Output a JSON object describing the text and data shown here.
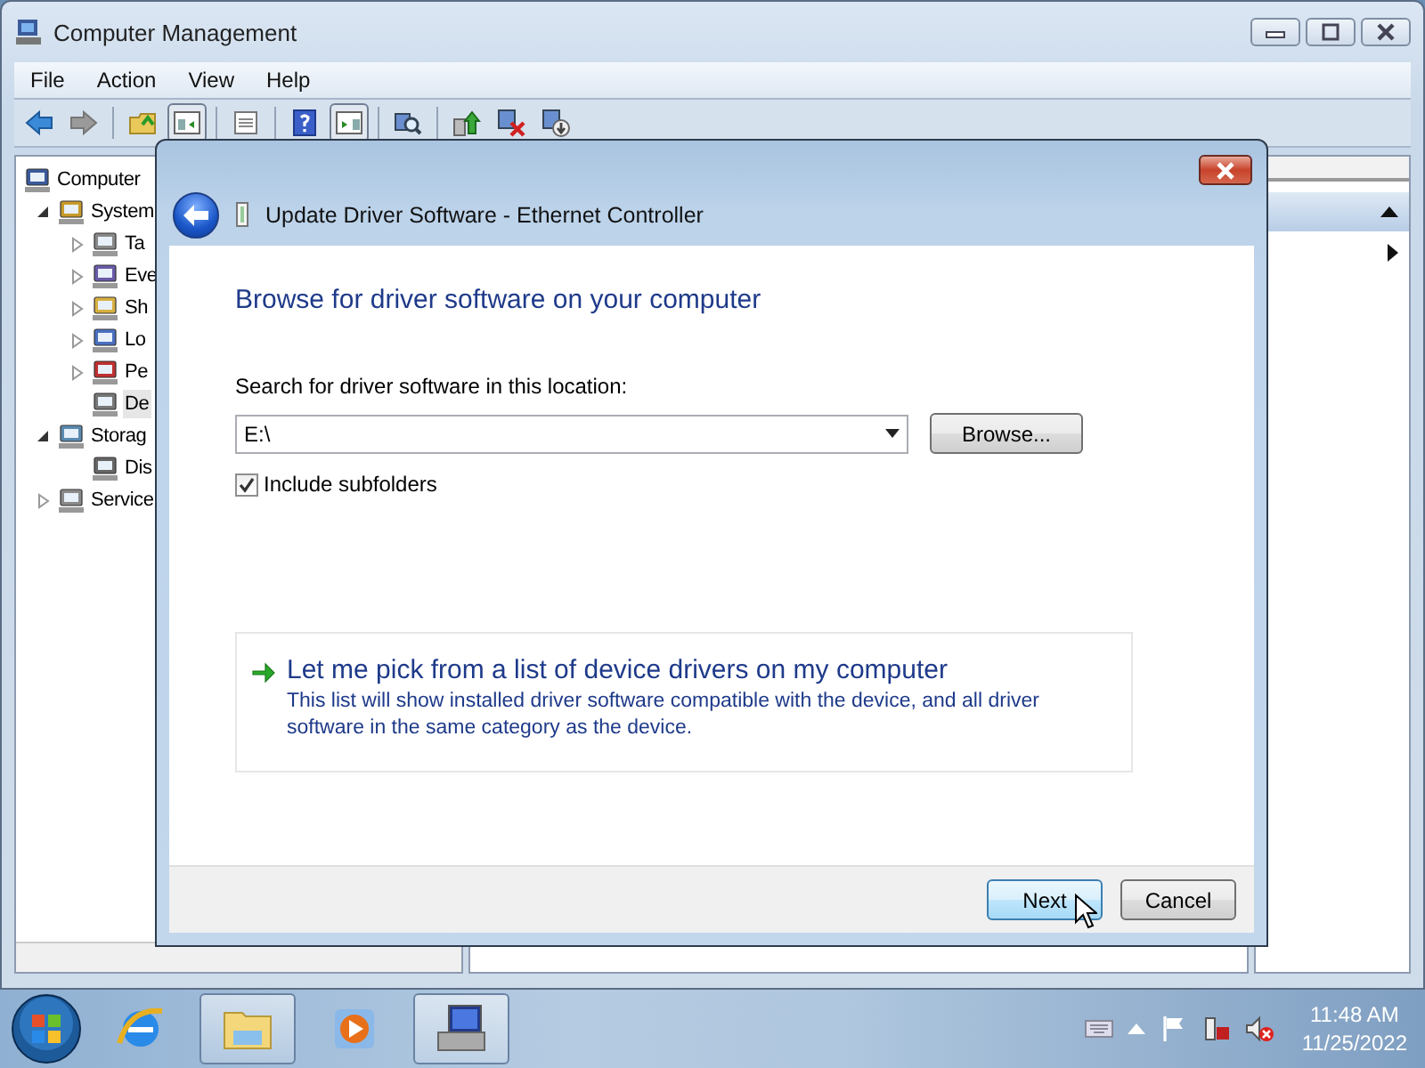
{
  "window": {
    "title": "Computer Management"
  },
  "menu": [
    "File",
    "Action",
    "View",
    "Help"
  ],
  "tree": [
    {
      "label": "Computer",
      "kind": "root",
      "selected": false,
      "children": [
        {
          "label": "System",
          "kind": "node",
          "expanded": true,
          "selected": false,
          "children": [
            {
              "label": "Ta",
              "kind": "node",
              "expanded": false,
              "selected": false
            },
            {
              "label": "Eve",
              "kind": "node",
              "expanded": false,
              "selected": false
            },
            {
              "label": "Sh",
              "kind": "node",
              "expanded": false,
              "selected": false
            },
            {
              "label": "Lo",
              "kind": "node",
              "expanded": false,
              "selected": false
            },
            {
              "label": "Pe",
              "kind": "node",
              "expanded": false,
              "selected": false
            },
            {
              "label": "De",
              "kind": "leaf",
              "selected": true
            }
          ]
        },
        {
          "label": "Storag",
          "kind": "node",
          "expanded": true,
          "selected": false,
          "children": [
            {
              "label": "Dis",
              "kind": "leaf",
              "selected": false
            }
          ]
        },
        {
          "label": "Service",
          "kind": "node",
          "expanded": false,
          "selected": false
        }
      ]
    }
  ],
  "dialog": {
    "title": "Update Driver Software - Ethernet Controller",
    "heading": "Browse for driver software on your computer",
    "location_label": "Search for driver software in this location:",
    "location_value": "E:\\",
    "browse_button": "Browse...",
    "include_subfolders": {
      "label": "Include subfolders",
      "checked": true
    },
    "pick_link": {
      "title": "Let me pick from a list of device drivers on my computer",
      "description": "This list will show installed driver software compatible with the device, and all driver software in the same category as the device."
    },
    "buttons": [
      {
        "label": "Next",
        "kind": "default"
      },
      {
        "label": "Cancel",
        "kind": "normal"
      }
    ]
  },
  "taskbar": {
    "time": "11:48 AM",
    "date": "11/25/2022"
  }
}
